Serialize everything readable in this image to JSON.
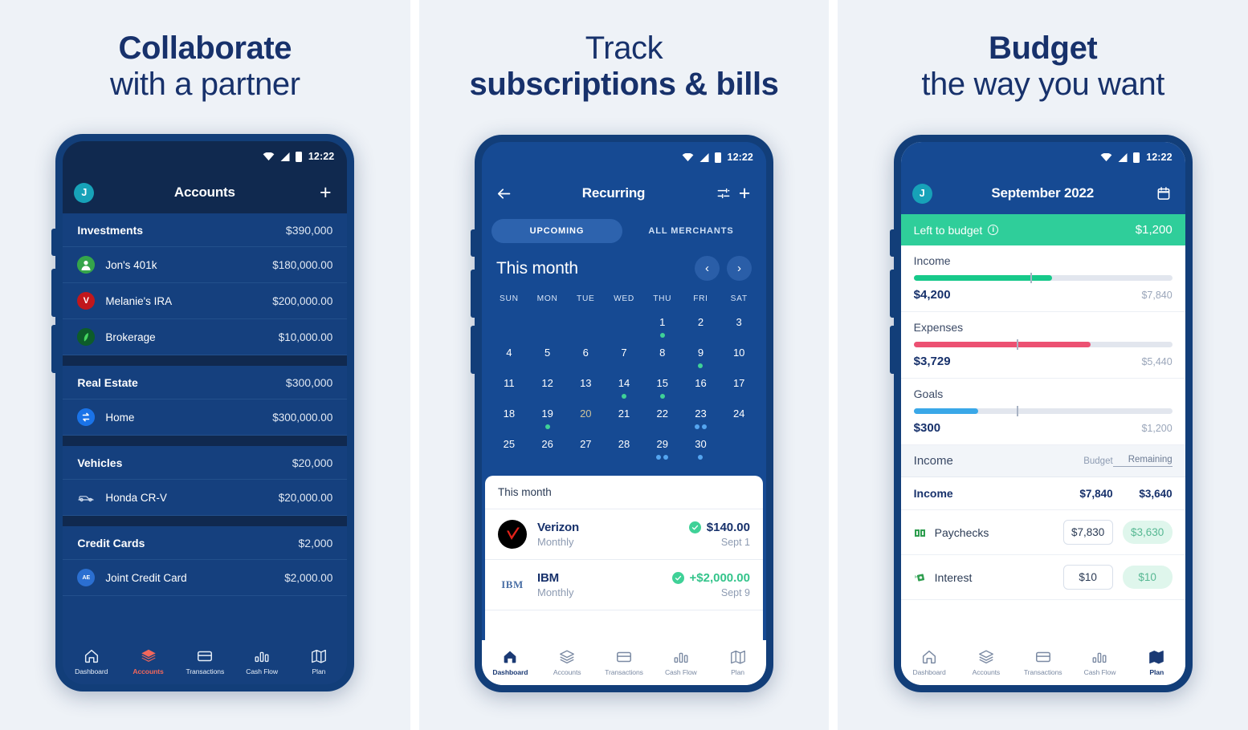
{
  "panels": [
    {
      "heading": {
        "line1": "Collaborate",
        "line1_weight": "bold",
        "line2": "with a partner",
        "line2_weight": "regular"
      },
      "status": {
        "time": "12:22"
      },
      "appbar": {
        "avatar": "J",
        "title": "Accounts",
        "action_icon": "plus-icon"
      },
      "groups": [
        {
          "name": "Investments",
          "total": "$390,000",
          "accounts": [
            {
              "name": "Jon's 401k",
              "value": "$180,000.00",
              "icon": "fidelity-logo-icon",
              "color": "#35a54a"
            },
            {
              "name": "Melanie's IRA",
              "value": "$200,000.00",
              "icon": "vanguard-logo-icon",
              "color": "#c1171c"
            },
            {
              "name": "Brokerage",
              "value": "$10,000.00",
              "icon": "leaf-logo-icon",
              "color": "#0d5c2a"
            }
          ]
        },
        {
          "name": "Real Estate",
          "total": "$300,000",
          "accounts": [
            {
              "name": "Home",
              "value": "$300,000.00",
              "icon": "home-loan-icon",
              "color": "#1a73e8"
            }
          ]
        },
        {
          "name": "Vehicles",
          "total": "$20,000",
          "accounts": [
            {
              "name": "Honda CR-V",
              "value": "$20,000.00",
              "icon": "car-icon",
              "color": "transparent"
            }
          ]
        },
        {
          "name": "Credit Cards",
          "total": "$2,000",
          "accounts": [
            {
              "name": "Joint Credit Card",
              "value": "$2,000.00",
              "icon": "amex-logo-icon",
              "color": "#2b6fd1"
            }
          ]
        }
      ],
      "nav": {
        "theme": "dark",
        "items": [
          {
            "label": "Dashboard",
            "icon": "home-icon",
            "active": false
          },
          {
            "label": "Accounts",
            "icon": "layers-icon",
            "active": true
          },
          {
            "label": "Transactions",
            "icon": "card-icon",
            "active": false
          },
          {
            "label": "Cash Flow",
            "icon": "bars-icon",
            "active": false
          },
          {
            "label": "Plan",
            "icon": "map-icon",
            "active": false
          }
        ]
      }
    },
    {
      "heading": {
        "line1": "Track",
        "line1_weight": "regular",
        "line2": "subscriptions & bills",
        "line2_weight": "bold"
      },
      "status": {
        "time": "12:22"
      },
      "appbar": {
        "back_icon": "back-arrow-icon",
        "title": "Recurring",
        "filter_icon": "filter-icon",
        "action_icon": "plus-icon"
      },
      "segments": [
        {
          "label": "UPCOMING",
          "active": true
        },
        {
          "label": "ALL MERCHANTS",
          "active": false
        }
      ],
      "calendar": {
        "month_label": "This month",
        "prev_icon": "chevron-left-icon",
        "next_icon": "chevron-right-icon",
        "dow": [
          "SUN",
          "MON",
          "TUE",
          "WED",
          "THU",
          "FRI",
          "SAT"
        ],
        "today": 20,
        "weeks": [
          [
            {},
            {},
            {},
            {},
            {
              "d": 1,
              "dots": [
                "green"
              ]
            },
            {
              "d": 2
            },
            {
              "d": 3
            }
          ],
          [
            {
              "d": 4
            },
            {
              "d": 5
            },
            {
              "d": 6
            },
            {
              "d": 7
            },
            {
              "d": 8
            },
            {
              "d": 9,
              "dots": [
                "green"
              ]
            },
            {
              "d": 10
            }
          ],
          [
            {
              "d": 11
            },
            {
              "d": 12
            },
            {
              "d": 13
            },
            {
              "d": 14,
              "dots": [
                "green"
              ]
            },
            {
              "d": 15,
              "dots": [
                "green"
              ]
            },
            {
              "d": 16
            },
            {
              "d": 17
            }
          ],
          [
            {
              "d": 18
            },
            {
              "d": 19,
              "dots": [
                "green"
              ]
            },
            {
              "d": 20
            },
            {
              "d": 21
            },
            {
              "d": 22
            },
            {
              "d": 23,
              "dots": [
                "blue",
                "blue"
              ]
            },
            {
              "d": 24
            }
          ],
          [
            {
              "d": 25
            },
            {
              "d": 26
            },
            {
              "d": 27
            },
            {
              "d": 28
            },
            {
              "d": 29,
              "dots": [
                "blue",
                "blue"
              ]
            },
            {
              "d": 30,
              "dots": [
                "blue"
              ]
            },
            {}
          ]
        ]
      },
      "sheet": {
        "header": "This month",
        "rows": [
          {
            "name": "Verizon",
            "sub": "Monthly",
            "amount": "$140.00",
            "positive": false,
            "date": "Sept 1",
            "logo": "verizon-logo-icon",
            "status_icon": "check-circle-icon"
          },
          {
            "name": "IBM",
            "sub": "Monthly",
            "amount": "+$2,000.00",
            "positive": true,
            "date": "Sept 9",
            "logo": "ibm-logo-icon",
            "status_icon": "check-circle-icon"
          }
        ]
      },
      "nav": {
        "theme": "light",
        "items": [
          {
            "label": "Dashboard",
            "icon": "home-icon",
            "active": true
          },
          {
            "label": "Accounts",
            "icon": "layers-icon",
            "active": false
          },
          {
            "label": "Transactions",
            "icon": "card-icon",
            "active": false
          },
          {
            "label": "Cash Flow",
            "icon": "bars-icon",
            "active": false
          },
          {
            "label": "Plan",
            "icon": "map-icon",
            "active": false
          }
        ]
      }
    },
    {
      "heading": {
        "line1": "Budget",
        "line1_weight": "bold",
        "line2": "the way you want",
        "line2_weight": "regular"
      },
      "status": {
        "time": "12:22"
      },
      "appbar": {
        "avatar": "J",
        "title": "September 2022",
        "action_icon": "calendar-icon"
      },
      "left_to_budget": {
        "label": "Left to budget",
        "info_icon": "info-icon",
        "amount": "$1,200",
        "color": "#2fce9a"
      },
      "summary": [
        {
          "name": "Income",
          "current": "$4,200",
          "total": "$7,840",
          "percent": 53.5,
          "marker": 45,
          "color": "#17c98a"
        },
        {
          "name": "Expenses",
          "current": "$3,729",
          "total": "$5,440",
          "percent": 68.5,
          "marker": 40,
          "color": "#ec5172"
        },
        {
          "name": "Goals",
          "current": "$300",
          "total": "$1,200",
          "percent": 25,
          "marker": 40,
          "color": "#3aa8e8"
        }
      ],
      "table": {
        "section": "Income",
        "col_budget": "Budget",
        "col_remaining": "Remaining",
        "rows": [
          {
            "name": "Income",
            "budget": "$7,840",
            "remaining": "$3,640",
            "total_row": true
          },
          {
            "name": "Paychecks",
            "budget": "$7,830",
            "remaining": "$3,630",
            "icon": "money-icon",
            "total_row": false
          },
          {
            "name": "Interest",
            "budget": "$10",
            "remaining": "$10",
            "icon": "money-wings-icon",
            "total_row": false
          }
        ]
      },
      "nav": {
        "theme": "light",
        "items": [
          {
            "label": "Dashboard",
            "icon": "home-icon",
            "active": false
          },
          {
            "label": "Accounts",
            "icon": "layers-icon",
            "active": false
          },
          {
            "label": "Transactions",
            "icon": "card-icon",
            "active": false
          },
          {
            "label": "Cash Flow",
            "icon": "bars-icon",
            "active": false
          },
          {
            "label": "Plan",
            "icon": "map-icon",
            "active": true
          }
        ]
      }
    }
  ]
}
